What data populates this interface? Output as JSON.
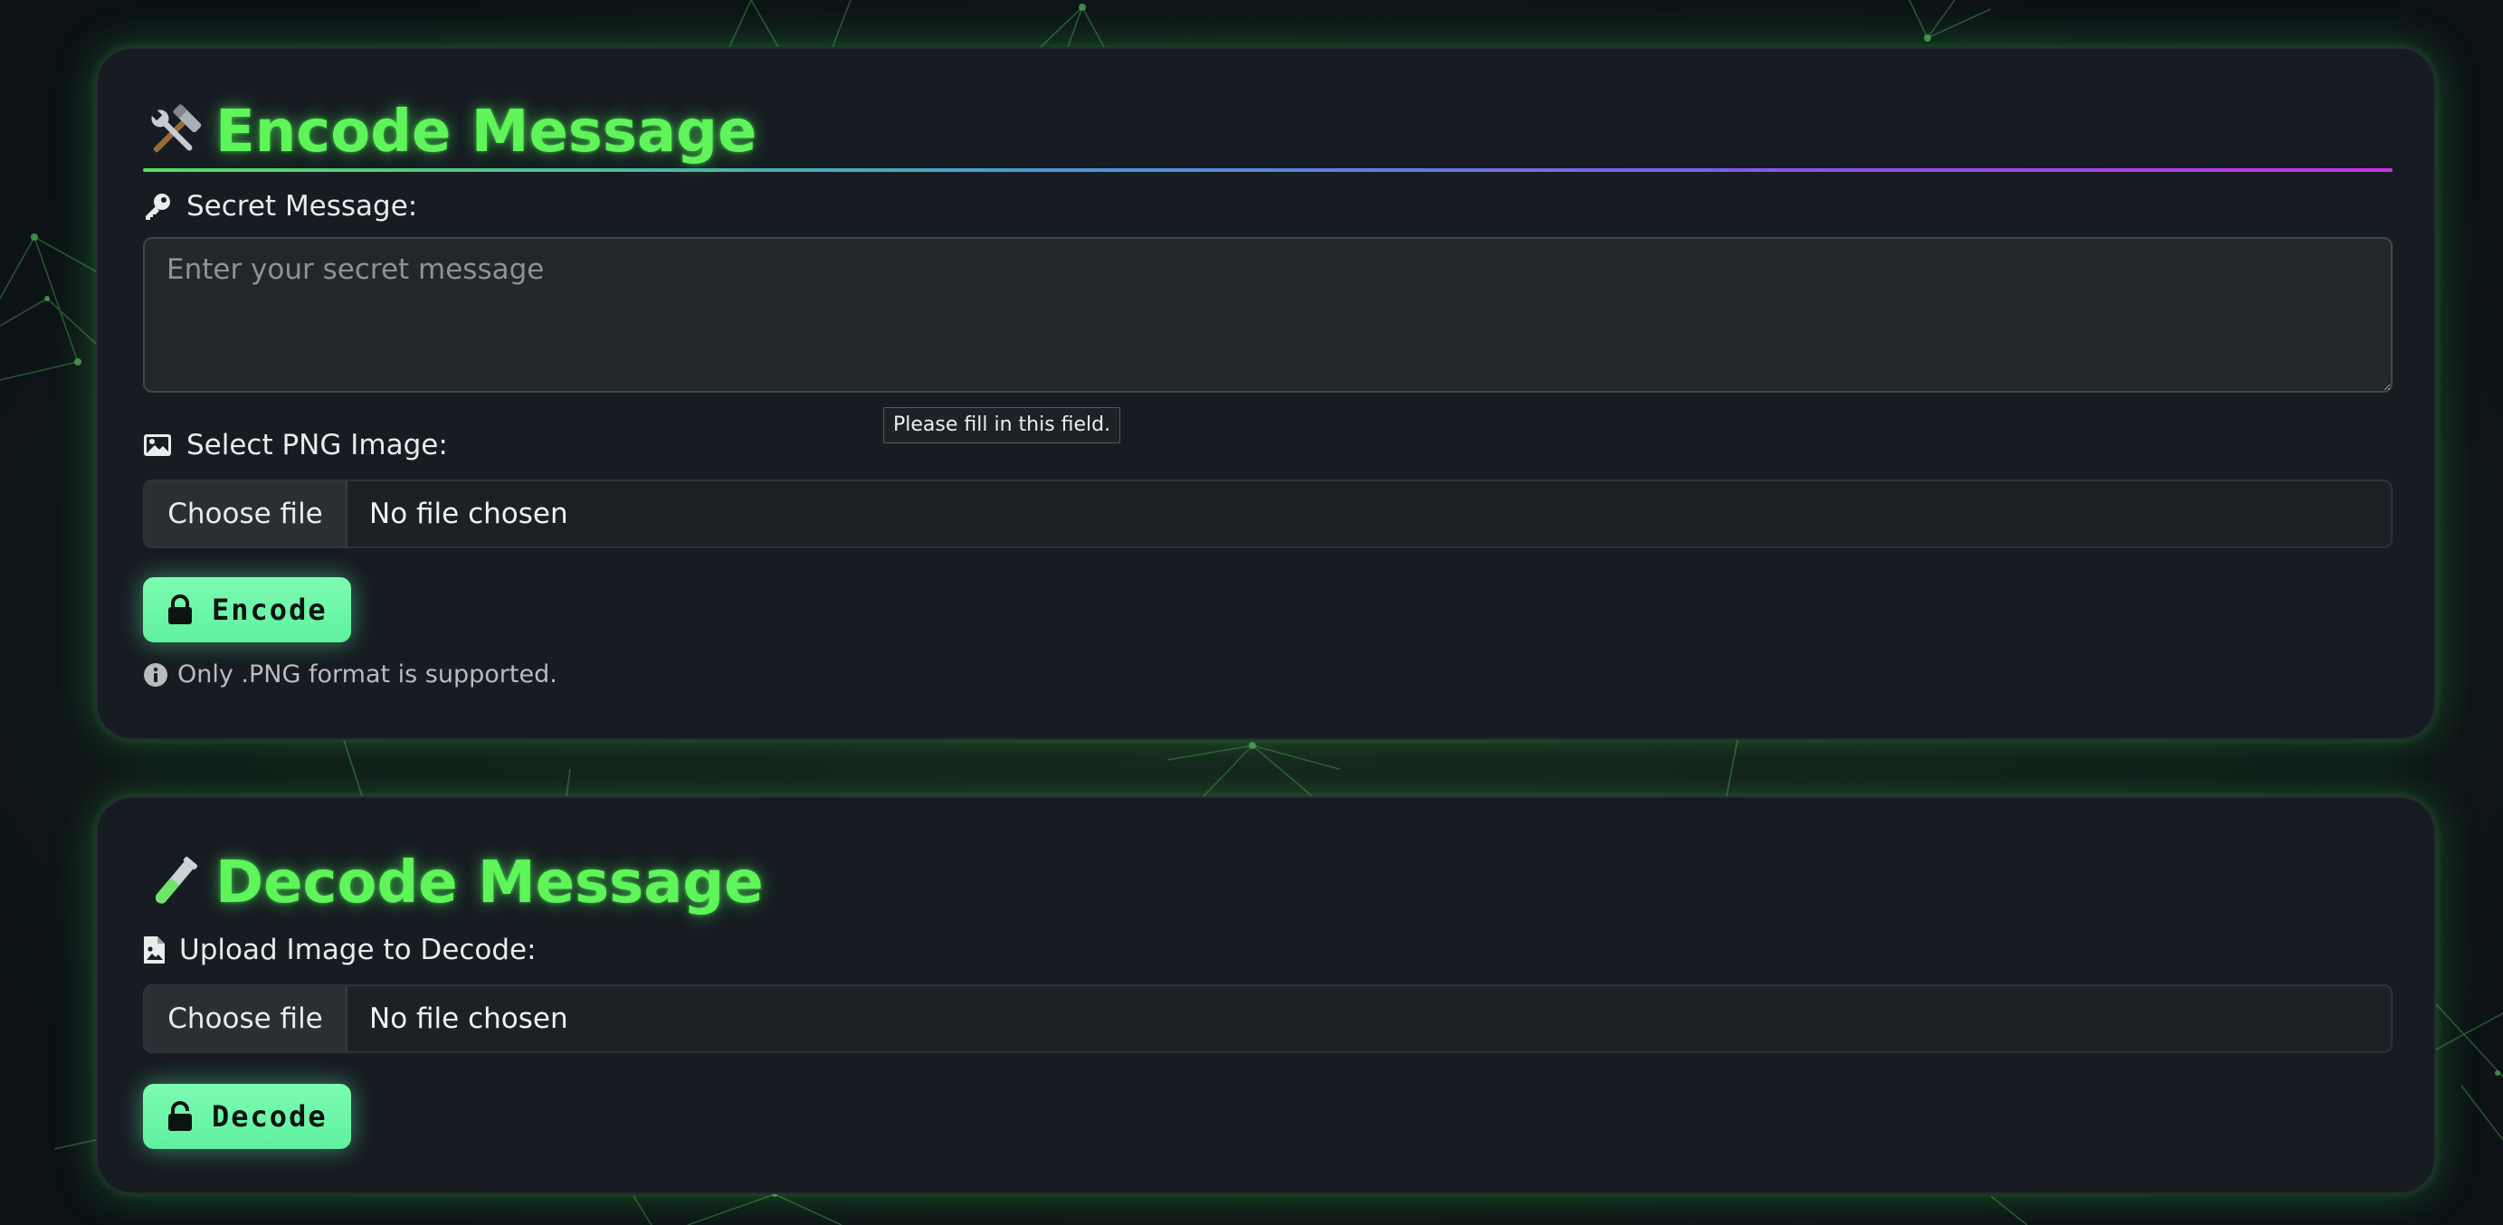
{
  "encode": {
    "title": "Encode Message",
    "title_icon": "hammer-and-wrench-icon",
    "message_label": "Secret Message:",
    "message_icon": "key-icon",
    "message_placeholder": "Enter your secret message",
    "message_value": "",
    "validation_tooltip": "Please fill in this field.",
    "image_label": "Select PNG Image:",
    "image_icon": "image-icon",
    "file_button": "Choose file",
    "file_status": "No file chosen",
    "submit_label": "Encode",
    "submit_icon": "lock-icon",
    "note": "Only .PNG format is supported.",
    "note_icon": "info-icon"
  },
  "decode": {
    "title": "Decode Message",
    "title_icon": "test-tube-icon",
    "upload_label": "Upload Image to Decode:",
    "upload_icon": "file-image-icon",
    "file_button": "Choose file",
    "file_status": "No file chosen",
    "submit_label": "Decode",
    "submit_icon": "unlock-icon"
  },
  "colors": {
    "accent_green": "#5ff55a",
    "button_green": "#6ff7aa",
    "card_background": "#171c22",
    "page_background": "#0f1519",
    "divider_gradient_start": "#53e05e",
    "divider_gradient_end": "#c933ea"
  }
}
